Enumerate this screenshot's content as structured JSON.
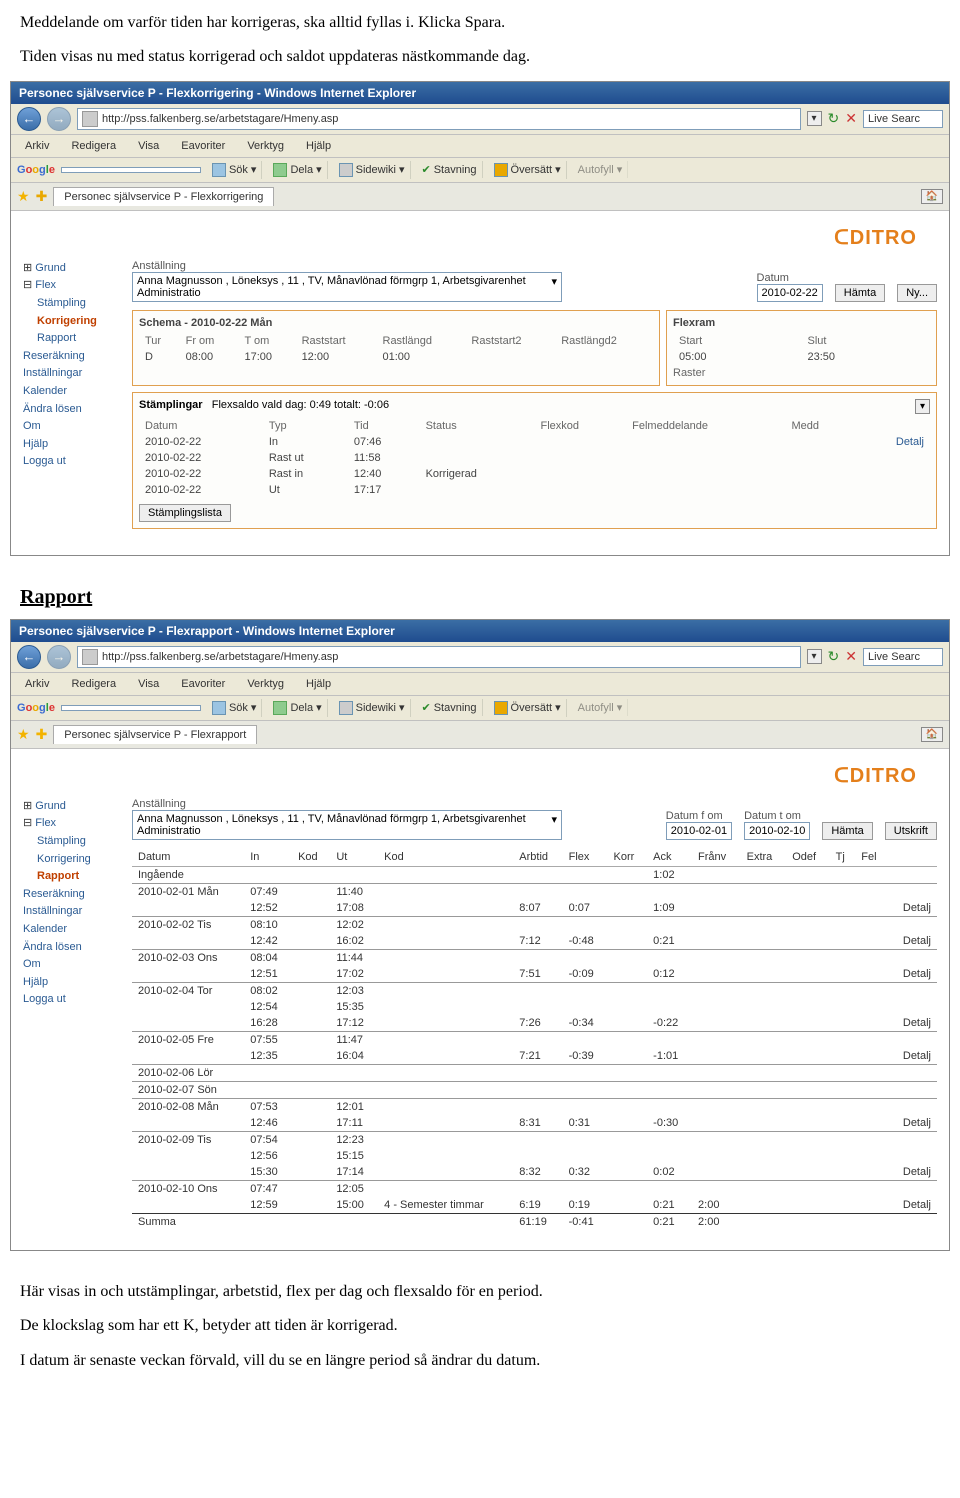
{
  "doc": {
    "intro1": "Meddelande om varför tiden har korrigeras, ska alltid fyllas i. Klicka Spara.",
    "intro2": "Tiden visas nu med status korrigerad och saldot uppdateras nästkommande dag.",
    "heading_rapport": "Rapport",
    "outro1": "Här visas in och utstämplingar, arbetstid, flex per dag och flexsaldo för en period.",
    "outro2": "De klockslag som har ett K, betyder att tiden är korrigerad.",
    "outro3": "I datum är senaste veckan förvald, vill du se en längre period så ändrar du datum."
  },
  "browser": {
    "title1": "Personec självservice P - Flexkorrigering - Windows Internet Explorer",
    "title2": "Personec självservice P - Flexrapport - Windows Internet Explorer",
    "url": "http://pss.falkenberg.se/arbetstagare/Hmeny.asp",
    "menus": [
      "Arkiv",
      "Redigera",
      "Visa",
      "Eavoriter",
      "Verktyg",
      "Hjälp"
    ],
    "google_label": "Google",
    "toolbar_items": [
      "Sök",
      "Dela",
      "Sidewiki",
      "Stavning",
      "Översätt",
      "Autofyll"
    ],
    "tab1": "Personec självservice P - Flexkorrigering",
    "tab2": "Personec självservice P - Flexrapport",
    "live": "Live Searc"
  },
  "brand": "ᑕDITRO",
  "sidenav": {
    "items": [
      "Grund",
      "Flex",
      "Stämpling",
      "Korrigering",
      "Rapport",
      "Reseräkning",
      "Inställningar",
      "Kalender",
      "Ändra lösen",
      "Om",
      "Hjälp",
      "Logga ut"
    ]
  },
  "flexkorr": {
    "anst_label": "Anställning",
    "anst_value": "Anna Magnusson , Löneksys , 11 , TV, Månavlönad förmgrp 1, Arbetsgivarenhet Administratio",
    "datum_label": "Datum",
    "datum_value": "2010-02-22",
    "btn_hamta": "Hämta",
    "btn_ny": "Ny...",
    "schema_title": "Schema - 2010-02-22 Mån",
    "schema_headers": [
      "Tur",
      "Fr om",
      "T om",
      "Raststart",
      "Rastlängd",
      "Raststart2",
      "Rastlängd2"
    ],
    "schema_row": [
      "D",
      "08:00",
      "17:00",
      "12:00",
      "01:00",
      "",
      ""
    ],
    "flexram_title": "Flexram",
    "flexram_headers": [
      "Start",
      "Slut"
    ],
    "flexram_row_label": "Raster",
    "flexram_row": [
      "05:00",
      "23:50"
    ],
    "stamp_title": "Stämplingar",
    "stamp_sub": "Flexsaldo vald dag: 0:49  totalt: -0:06",
    "stamp_headers": [
      "Datum",
      "Typ",
      "Tid",
      "Status",
      "Flexkod",
      "Felmeddelande",
      "Medd"
    ],
    "stamp_rows": [
      {
        "d": "2010-02-22",
        "t": "In",
        "tid": "07:46",
        "st": "",
        "detalj": "Detalj"
      },
      {
        "d": "2010-02-22",
        "t": "Rast ut",
        "tid": "11:58",
        "st": "",
        "detalj": ""
      },
      {
        "d": "2010-02-22",
        "t": "Rast in",
        "tid": "12:40",
        "st": "Korrigerad",
        "detalj": ""
      },
      {
        "d": "2010-02-22",
        "t": "Ut",
        "tid": "17:17",
        "st": "",
        "detalj": ""
      }
    ],
    "btn_lista": "Stämplingslista"
  },
  "flexrapport": {
    "anst_label": "Anställning",
    "anst_value": "Anna Magnusson , Löneksys , 11 , TV, Månavlönad förmgrp 1, Arbetsgivarenhet Administratio",
    "datum_fom_label": "Datum f om",
    "datum_tom_label": "Datum t om",
    "datum_fom": "2010-02-01",
    "datum_tom": "2010-02-10",
    "btn_hamta": "Hämta",
    "btn_utskrift": "Utskrift",
    "headers": [
      "Datum",
      "In",
      "Kod",
      "Ut",
      "Kod",
      "Arbtid",
      "Flex",
      "Korr",
      "Ack",
      "Frånv",
      "Extra",
      "Odef",
      "Tj",
      "Fel"
    ],
    "ingaende": "Ingående",
    "ingaende_ack": "1:02",
    "rows": [
      {
        "first": true,
        "d": "2010-02-01 Mån",
        "in": "07:49",
        "kin": "",
        "ut": "11:40",
        "kut": "",
        "arb": "",
        "flex": "",
        "korr": "",
        "ack": "",
        "franv": "",
        "extra": "",
        "odef": "",
        "tj": "",
        "fel": "",
        "det": ""
      },
      {
        "d": "",
        "in": "12:52",
        "ut": "17:08",
        "arb": "8:07",
        "flex": "0:07",
        "ack": "1:09",
        "det": "Detalj"
      },
      {
        "first": true,
        "d": "2010-02-02 Tis",
        "in": "08:10",
        "ut": "12:02"
      },
      {
        "d": "",
        "in": "12:42",
        "ut": "16:02",
        "arb": "7:12",
        "flex": "-0:48",
        "ack": "0:21",
        "det": "Detalj"
      },
      {
        "first": true,
        "d": "2010-02-03 Ons",
        "in": "08:04",
        "ut": "11:44"
      },
      {
        "d": "",
        "in": "12:51",
        "ut": "17:02",
        "arb": "7:51",
        "flex": "-0:09",
        "ack": "0:12",
        "det": "Detalj"
      },
      {
        "first": true,
        "d": "2010-02-04 Tor",
        "in": "08:02",
        "ut": "12:03"
      },
      {
        "d": "",
        "in": "12:54",
        "ut": "15:35"
      },
      {
        "d": "",
        "in": "16:28",
        "ut": "17:12",
        "arb": "7:26",
        "flex": "-0:34",
        "ack": "-0:22",
        "det": "Detalj"
      },
      {
        "first": true,
        "d": "2010-02-05 Fre",
        "in": "07:55",
        "ut": "11:47"
      },
      {
        "d": "",
        "in": "12:35",
        "ut": "16:04",
        "arb": "7:21",
        "flex": "-0:39",
        "ack": "-1:01",
        "det": "Detalj"
      },
      {
        "first": true,
        "d": "2010-02-06 Lör"
      },
      {
        "first": true,
        "d": "2010-02-07 Sön"
      },
      {
        "first": true,
        "d": "2010-02-08 Mån",
        "in": "07:53",
        "ut": "12:01"
      },
      {
        "d": "",
        "in": "12:46",
        "ut": "17:11",
        "arb": "8:31",
        "flex": "0:31",
        "ack": "-0:30",
        "det": "Detalj"
      },
      {
        "first": true,
        "d": "2010-02-09 Tis",
        "in": "07:54",
        "ut": "12:23"
      },
      {
        "d": "",
        "in": "12:56",
        "ut": "15:15"
      },
      {
        "d": "",
        "in": "15:30",
        "ut": "17:14",
        "arb": "8:32",
        "flex": "0:32",
        "ack": "0:02",
        "det": "Detalj"
      },
      {
        "first": true,
        "d": "2010-02-10 Ons",
        "in": "07:47",
        "ut": "12:05"
      },
      {
        "d": "",
        "in": "12:59",
        "ut": "15:00",
        "kut": "4 - Semester timmar",
        "arb": "6:19",
        "flex": "0:19",
        "ack": "0:21",
        "franv": "2:00",
        "det": "Detalj"
      }
    ],
    "summa_label": "Summa",
    "summa": {
      "arb": "61:19",
      "flex": "-0:41",
      "ack": "0:21",
      "franv": "2:00"
    }
  }
}
